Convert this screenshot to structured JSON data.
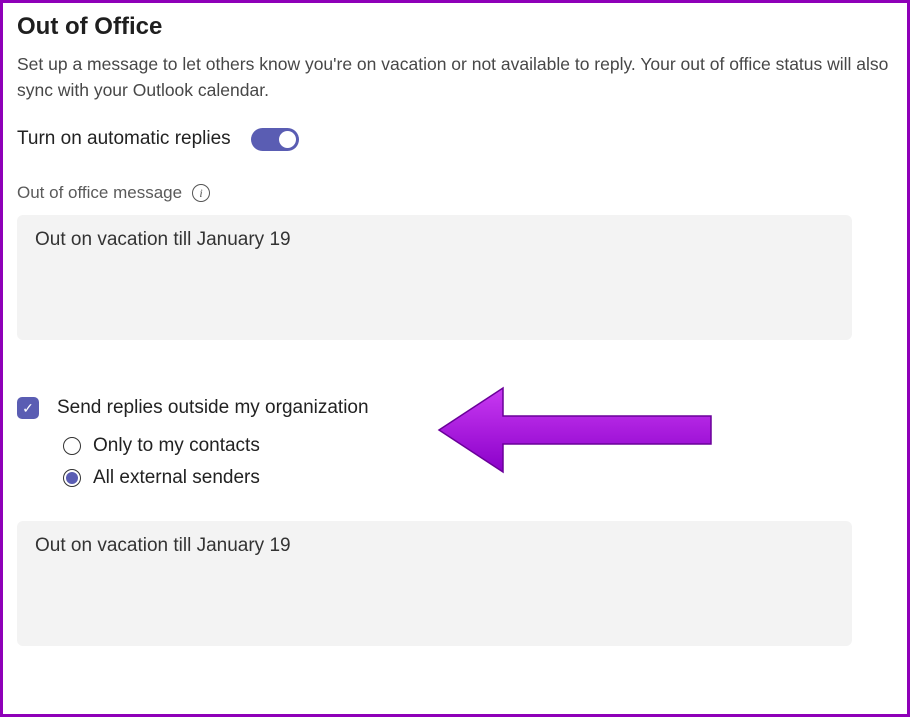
{
  "title": "Out of Office",
  "description": "Set up a message to let others know you're on vacation or not available to reply. Your out of office status will also sync with your Outlook calendar.",
  "toggle": {
    "label": "Turn on automatic replies",
    "on": true
  },
  "message": {
    "label": "Out of office message",
    "value": "Out on vacation till January 19"
  },
  "sendOutside": {
    "label": "Send replies outside my organization",
    "checked": true,
    "options": {
      "contacts": "Only to my contacts",
      "allExternal": "All external senders",
      "selected": "allExternal"
    },
    "externalMessage": "Out on vacation till January 19"
  },
  "colors": {
    "accent": "#5a5db3",
    "frame": "#8e00b8",
    "annotation": "#b400e6"
  }
}
